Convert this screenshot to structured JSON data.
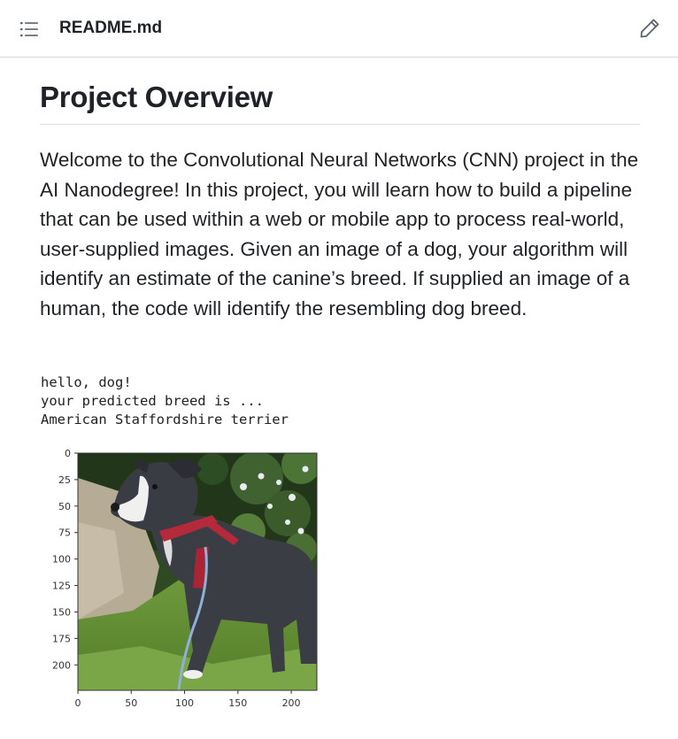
{
  "header": {
    "toc_icon": "list-unordered-icon",
    "file_name": "README.md",
    "edit_icon": "pencil-icon"
  },
  "readme": {
    "heading": "Project Overview",
    "paragraph": "Welcome to the Convolutional Neural Networks (CNN) project in the AI Nanodegree! In this project, you will learn how to build a pipeline that can be used within a web or mobile app to process real-world, user-supplied images. Given an image of a dog, your algorithm will identify an estimate of the canine’s breed. If supplied an image of a human, the code will identify the resembling dog breed.",
    "output_lines": [
      "hello, dog!",
      "your predicted breed is ...",
      "American Staffordshire terrier"
    ]
  },
  "plot": {
    "image_subject": "dog-photo",
    "y_ticks": [
      "0",
      "25",
      "50",
      "75",
      "100",
      "125",
      "150",
      "175",
      "200"
    ],
    "x_ticks": [
      "0",
      "50",
      "100",
      "150",
      "200"
    ]
  },
  "colors": {
    "text": "#1f2328",
    "border": "#d0d7de",
    "icon": "#59636e"
  }
}
